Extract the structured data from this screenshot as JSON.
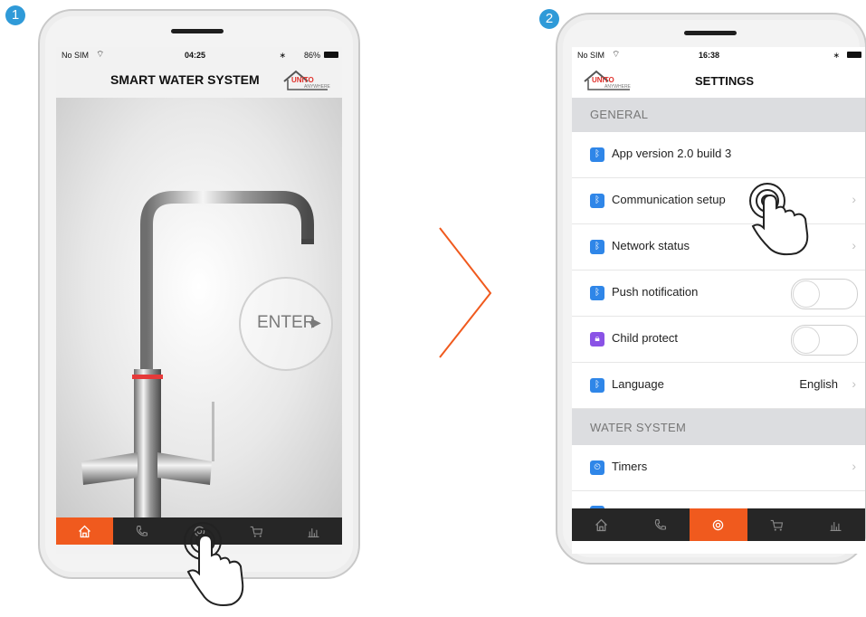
{
  "steps": [
    "1",
    "2"
  ],
  "phone1": {
    "status": {
      "carrier": "No SIM",
      "time": "04:25",
      "battery": "86%"
    },
    "title": "SMART WATER SYSTEM",
    "logo": {
      "brand": "UNITO",
      "sub": "ANYWHERE"
    },
    "enter_label": "ENTER",
    "tabs": [
      "home-icon",
      "phone-icon",
      "settings-icon",
      "cart-icon",
      "stats-icon"
    ]
  },
  "phone2": {
    "status": {
      "carrier": "No SIM",
      "time": "16:38"
    },
    "title": "SETTINGS",
    "logo": {
      "brand": "UNITO",
      "sub": "ANYWHERE"
    },
    "sections": {
      "general": "GENERAL",
      "water": "WATER SYSTEM"
    },
    "rows": {
      "app_version": "App version 2.0 build 3",
      "communication": "Communication setup",
      "network": "Network status",
      "push": "Push notification",
      "child": "Child protect",
      "language": "Language",
      "language_value": "English",
      "timers": "Timers"
    },
    "toggles": {
      "push": false,
      "child": false
    },
    "tabs": [
      "home-icon",
      "phone-icon",
      "settings-icon",
      "cart-icon",
      "stats-icon"
    ]
  },
  "colors": {
    "accent": "#f05a1e",
    "icon_blue": "#2f86e8",
    "icon_purple": "#8a52e6",
    "step_blue": "#2f9ad8"
  }
}
